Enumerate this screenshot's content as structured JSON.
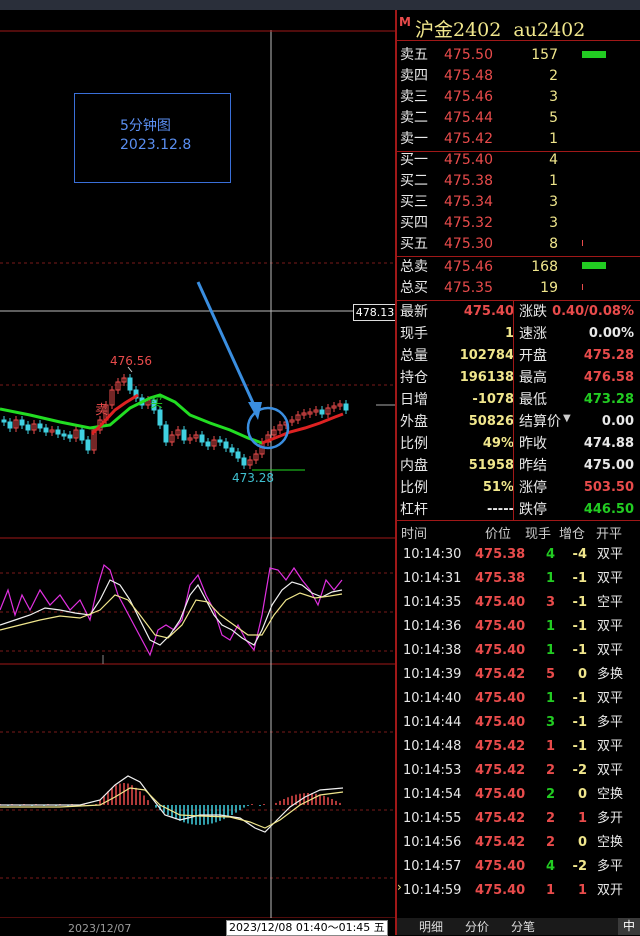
{
  "chart": {
    "price_tag": "478.13",
    "note_title": "5分钟图",
    "note_date": "2023.12.8",
    "high_label": "476.56",
    "low_label": "473.28",
    "sell_signal": "卖",
    "buy_signal": "买",
    "axis_date": "2023/12/07",
    "cursor_time": "2023/12/08 01:40～01:45 五"
  },
  "panel": {
    "badge": "M",
    "title": "沪金2402  au2402",
    "asks": [
      {
        "label": "卖五",
        "price": "475.50",
        "vol": "157"
      },
      {
        "label": "卖四",
        "price": "475.48",
        "vol": "2"
      },
      {
        "label": "卖三",
        "price": "475.46",
        "vol": "3"
      },
      {
        "label": "卖二",
        "price": "475.44",
        "vol": "5"
      },
      {
        "label": "卖一",
        "price": "475.42",
        "vol": "1"
      }
    ],
    "bids": [
      {
        "label": "买一",
        "price": "475.40",
        "vol": "4"
      },
      {
        "label": "买二",
        "price": "475.38",
        "vol": "1"
      },
      {
        "label": "买三",
        "price": "475.34",
        "vol": "3"
      },
      {
        "label": "买四",
        "price": "475.32",
        "vol": "3"
      },
      {
        "label": "买五",
        "price": "475.30",
        "vol": "8"
      }
    ],
    "totals": [
      {
        "label": "总卖",
        "price": "475.46",
        "vol": "168"
      },
      {
        "label": "总买",
        "price": "475.35",
        "vol": "19"
      }
    ],
    "stats": [
      {
        "l1": "最新",
        "v1": "475.40",
        "c1": "#e84b4b",
        "l2": "涨跌",
        "v2": "0.40/0.08%",
        "c2": "#e84b4b"
      },
      {
        "l1": "现手",
        "v1": "1",
        "c1": "#f0e68c",
        "l2": "速涨",
        "v2": "0.00%",
        "c2": "#e8e8e8"
      },
      {
        "l1": "总量",
        "v1": "102784",
        "c1": "#f0e68c",
        "l2": "开盘",
        "v2": "475.28",
        "c2": "#e84b4b"
      },
      {
        "l1": "持仓",
        "v1": "196138",
        "c1": "#f0e68c",
        "l2": "最高",
        "v2": "476.58",
        "c2": "#e84b4b"
      },
      {
        "l1": "日增",
        "v1": "-1078",
        "c1": "#f0e68c",
        "l2": "最低",
        "v2": "473.28",
        "c2": "#22cc22"
      },
      {
        "l1": "外盘",
        "v1": "50826",
        "c1": "#f0e68c",
        "l2": "结算价",
        "v2": "0.00",
        "c2": "#e8e8e8"
      },
      {
        "l1": "比例",
        "v1": "49%",
        "c1": "#f0e68c",
        "l2": "昨收",
        "v2": "474.88",
        "c2": "#e8e8e8"
      },
      {
        "l1": "内盘",
        "v1": "51958",
        "c1": "#f0e68c",
        "l2": "昨结",
        "v2": "475.00",
        "c2": "#e8e8e8"
      },
      {
        "l1": "比例",
        "v1": "51%",
        "c1": "#f0e68c",
        "l2": "涨停",
        "v2": "503.50",
        "c2": "#e84b4b"
      },
      {
        "l1": "杠杆",
        "v1": "-----",
        "c1": "#e8e8e8",
        "l2": "跌停",
        "v2": "446.50",
        "c2": "#22cc22"
      }
    ],
    "tick_headers": {
      "time": "时间",
      "price": "价位",
      "vol": "现手",
      "chg": "增仓",
      "type": "开平"
    },
    "ticks": [
      {
        "time": "10:14:30",
        "price": "475.38",
        "vol": "4",
        "chg": "-4",
        "type": "双平"
      },
      {
        "time": "10:14:31",
        "price": "475.38",
        "vol": "1",
        "chg": "-1",
        "type": "双平"
      },
      {
        "time": "10:14:35",
        "price": "475.40",
        "vol": "3",
        "chg": "-1",
        "type": "空平"
      },
      {
        "time": "10:14:36",
        "price": "475.40",
        "vol": "1",
        "chg": "-1",
        "type": "双平"
      },
      {
        "time": "10:14:38",
        "price": "475.40",
        "vol": "1",
        "chg": "-1",
        "type": "双平"
      },
      {
        "time": "10:14:39",
        "price": "475.42",
        "vol": "5",
        "chg": "0",
        "type": "多换"
      },
      {
        "time": "10:14:40",
        "price": "475.40",
        "vol": "1",
        "chg": "-1",
        "type": "双平"
      },
      {
        "time": "10:14:44",
        "price": "475.40",
        "vol": "3",
        "chg": "-1",
        "type": "多平"
      },
      {
        "time": "10:14:48",
        "price": "475.42",
        "vol": "1",
        "chg": "-1",
        "type": "双平"
      },
      {
        "time": "10:14:53",
        "price": "475.42",
        "vol": "2",
        "chg": "-2",
        "type": "双平"
      },
      {
        "time": "10:14:54",
        "price": "475.40",
        "vol": "2",
        "chg": "0",
        "type": "空换"
      },
      {
        "time": "10:14:55",
        "price": "475.42",
        "vol": "2",
        "chg": "1",
        "type": "多开"
      },
      {
        "time": "10:14:56",
        "price": "475.42",
        "vol": "2",
        "chg": "0",
        "type": "空换"
      },
      {
        "time": "10:14:57",
        "price": "475.40",
        "vol": "4",
        "chg": "-2",
        "type": "多平"
      },
      {
        "time": "10:14:59",
        "price": "475.40",
        "vol": "1",
        "chg": "1",
        "type": "双开"
      }
    ],
    "tabs": [
      "明细",
      "分价",
      "分笔"
    ],
    "lang": "中"
  }
}
